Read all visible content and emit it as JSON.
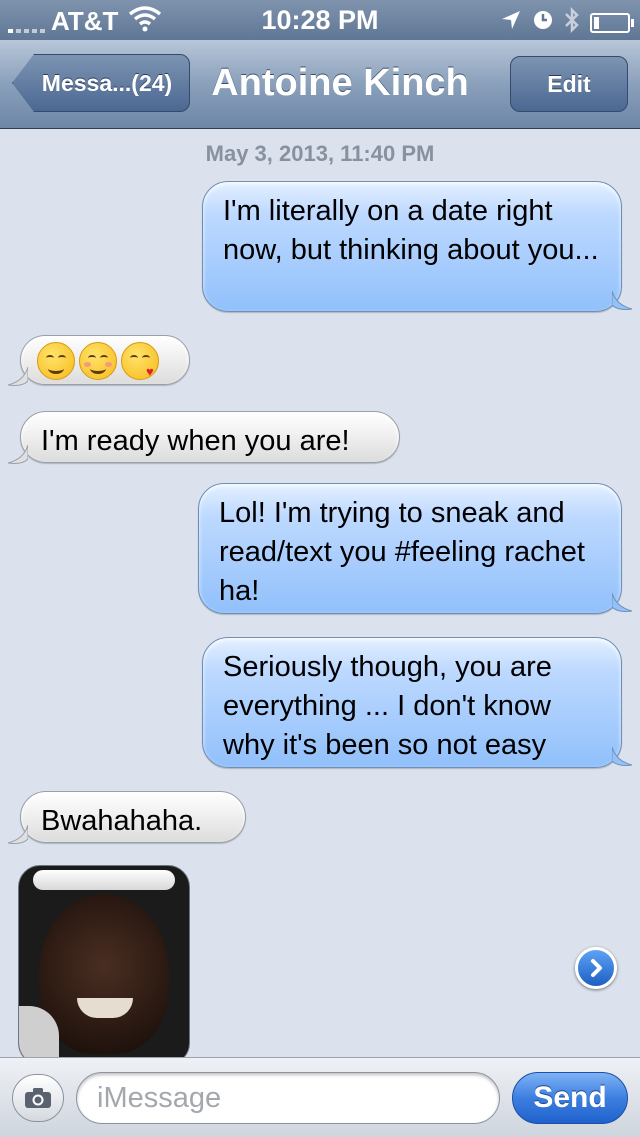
{
  "status_bar": {
    "carrier": "AT&T",
    "time": "10:28 PM",
    "signal_bars": 1,
    "battery_level": 0.15
  },
  "nav": {
    "back_label": "Messa...(24)",
    "title": "Antoine Kinch",
    "edit_label": "Edit"
  },
  "conversation": {
    "timestamp": "May 3, 2013, 11:40 PM",
    "messages": [
      {
        "direction": "outgoing",
        "text": "I'm literally on a date right now, but thinking about you..."
      },
      {
        "direction": "incoming",
        "emoji": [
          "smiling-face-icon",
          "blushing-face-icon",
          "kissing-face-icon"
        ]
      },
      {
        "direction": "incoming",
        "text": "I'm ready when you are!"
      },
      {
        "direction": "outgoing",
        "text": "Lol! I'm trying to sneak and read/text you #feeling rachet ha!"
      },
      {
        "direction": "outgoing",
        "text": "Seriously though, you are everything ... I don't know why it's been so not easy"
      },
      {
        "direction": "incoming",
        "text": "Bwahahaha."
      },
      {
        "direction": "incoming",
        "attachment": "photo"
      }
    ]
  },
  "input_bar": {
    "placeholder": "iMessage",
    "send_label": "Send"
  },
  "colors": {
    "outgoing_bubble": "#9cc6fb",
    "incoming_bubble": "#efefef",
    "nav_bar": "#8aa0bb",
    "send_button": "#3d7fe0",
    "background": "#dbe2ed"
  }
}
